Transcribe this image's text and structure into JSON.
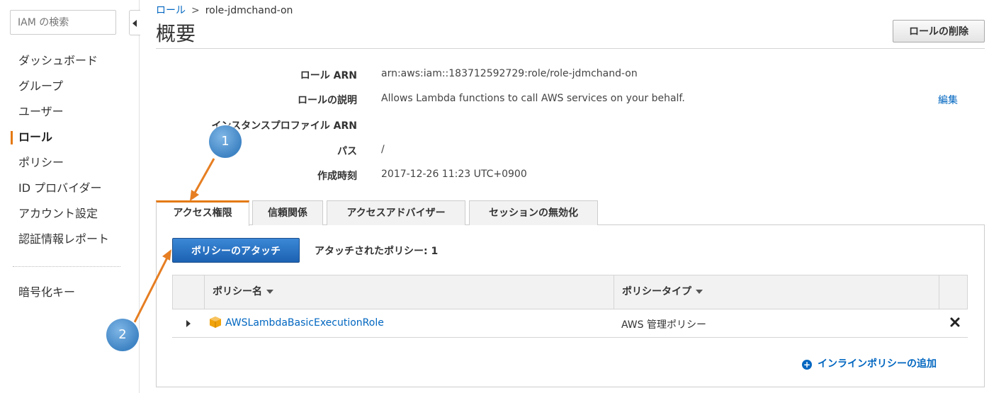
{
  "sidebar": {
    "search_placeholder": "IAM の検索",
    "items": [
      {
        "label": "ダッシュボード"
      },
      {
        "label": "グループ"
      },
      {
        "label": "ユーザー"
      },
      {
        "label": "ロール",
        "active": true
      },
      {
        "label": "ポリシー"
      },
      {
        "label": "ID プロバイダー"
      },
      {
        "label": "アカウント設定"
      },
      {
        "label": "認証情報レポート"
      }
    ],
    "extra_items": [
      {
        "label": "暗号化キー"
      }
    ]
  },
  "breadcrumb": {
    "parent": "ロール",
    "separator": ">",
    "current": "role-jdmchand-on"
  },
  "header": {
    "title": "概要",
    "delete_button": "ロールの削除"
  },
  "summary": {
    "rows": [
      {
        "label": "ロール ARN",
        "value": "arn:aws:iam::183712592729:role/role-jdmchand-on"
      },
      {
        "label": "ロールの説明",
        "value": "Allows Lambda functions to call AWS services on your behalf."
      },
      {
        "label": "インスタンスプロファイル ARN",
        "value": ""
      },
      {
        "label": "パス",
        "value": "/"
      },
      {
        "label": "作成時刻",
        "value": "2017-12-26 11:23 UTC+0900"
      }
    ],
    "edit_link": "編集"
  },
  "tabs": [
    {
      "label": "アクセス権限",
      "active": true
    },
    {
      "label": "信頼関係"
    },
    {
      "label": "アクセスアドバイザー"
    },
    {
      "label": "セッションの無効化"
    }
  ],
  "permissions": {
    "attach_button": "ポリシーのアタッチ",
    "attached_count_text": "アタッチされたポリシー: 1",
    "table": {
      "columns": [
        "ポリシー名",
        "ポリシータイプ"
      ],
      "rows": [
        {
          "name": "AWSLambdaBasicExecutionRole",
          "type": "AWS 管理ポリシー"
        }
      ]
    },
    "add_inline": "インラインポリシーの追加"
  },
  "callouts": [
    "1",
    "2"
  ],
  "colors": {
    "accent": "#e47911",
    "link": "#0066c0",
    "primary_button": "#1d62b3",
    "callout": "#3f84c4"
  },
  "icons": [
    "collapse-left-icon",
    "expand-caret-icon",
    "policy-box-icon",
    "remove-x-icon",
    "plus-circle-icon",
    "sort-caret-icon"
  ]
}
